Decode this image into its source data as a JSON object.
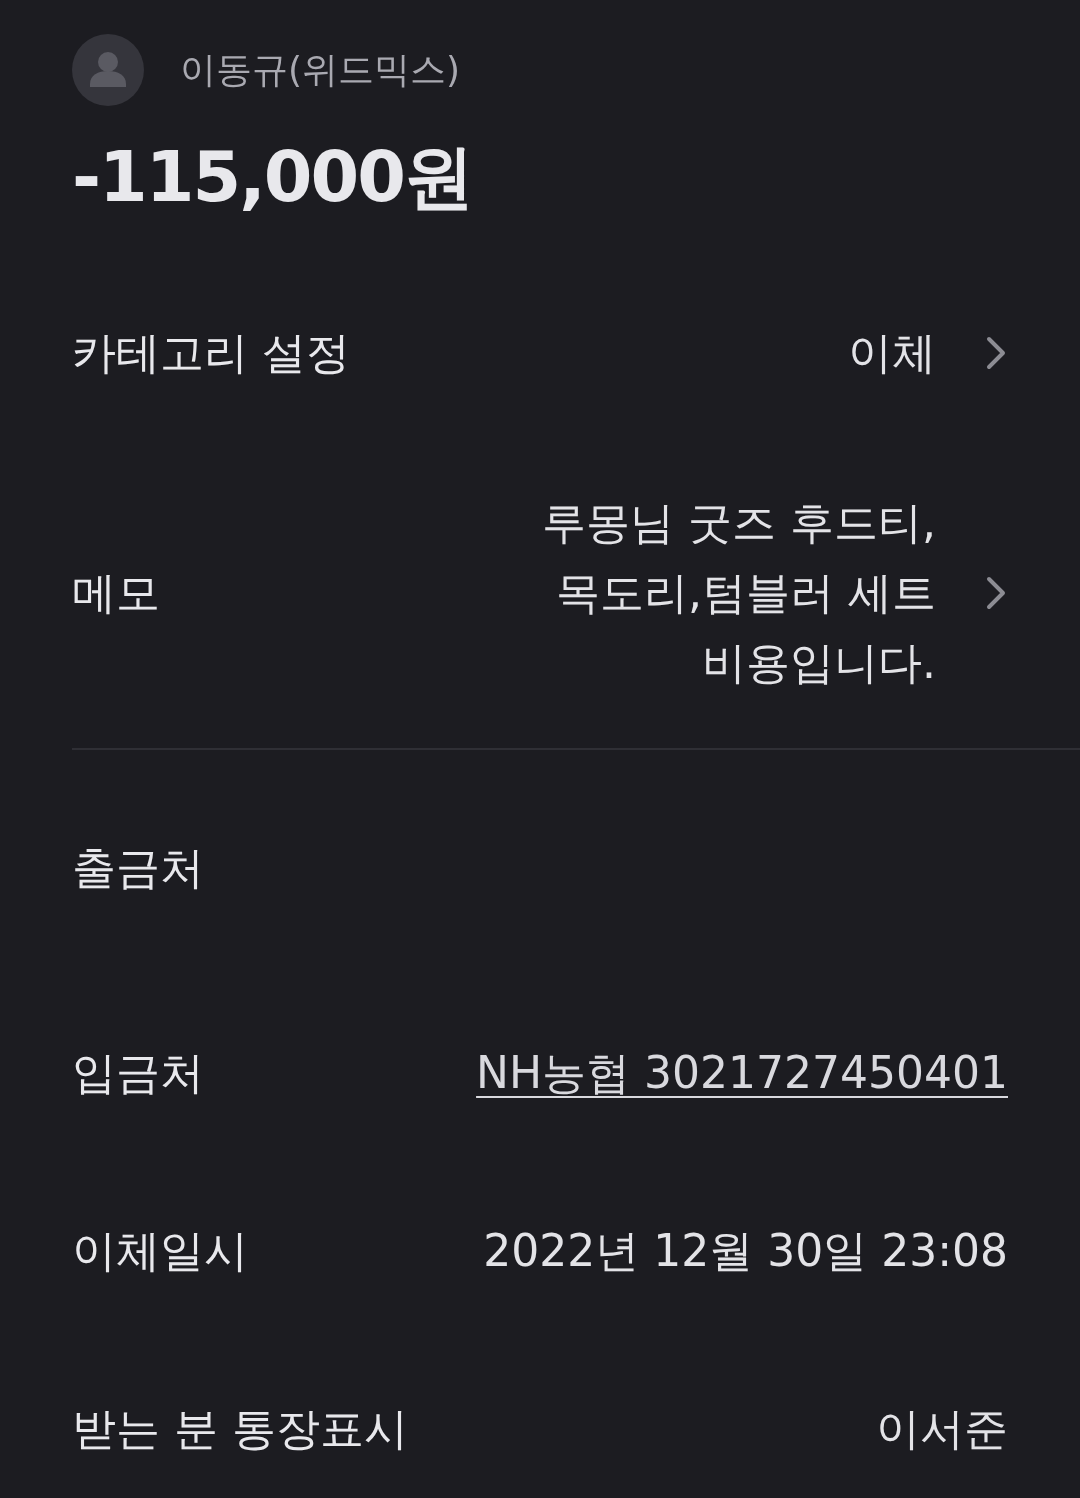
{
  "header": {
    "name": "이동규(위드믹스)",
    "amount": "-115,000원"
  },
  "groups": [
    [
      {
        "label": "카테고리 설정",
        "kind": "chevron",
        "lines": [
          "이체"
        ]
      },
      {
        "label": "메모",
        "kind": "chevron",
        "lines": [
          "루몽님 굿즈 후드티,",
          "목도리,텀블러 세트",
          "비용입니다."
        ]
      }
    ],
    [
      {
        "label": "출금처",
        "kind": "plain"
      },
      {
        "label": "입금처",
        "kind": "link",
        "lines": [
          "NH농협 3021727450401"
        ]
      },
      {
        "label": "이체일시",
        "kind": "plain",
        "lines": [
          "2022년 12월 30일 23:08"
        ]
      },
      {
        "label": "받는 분 통장표시",
        "kind": "plain",
        "lines": [
          "이서준"
        ]
      }
    ]
  ]
}
